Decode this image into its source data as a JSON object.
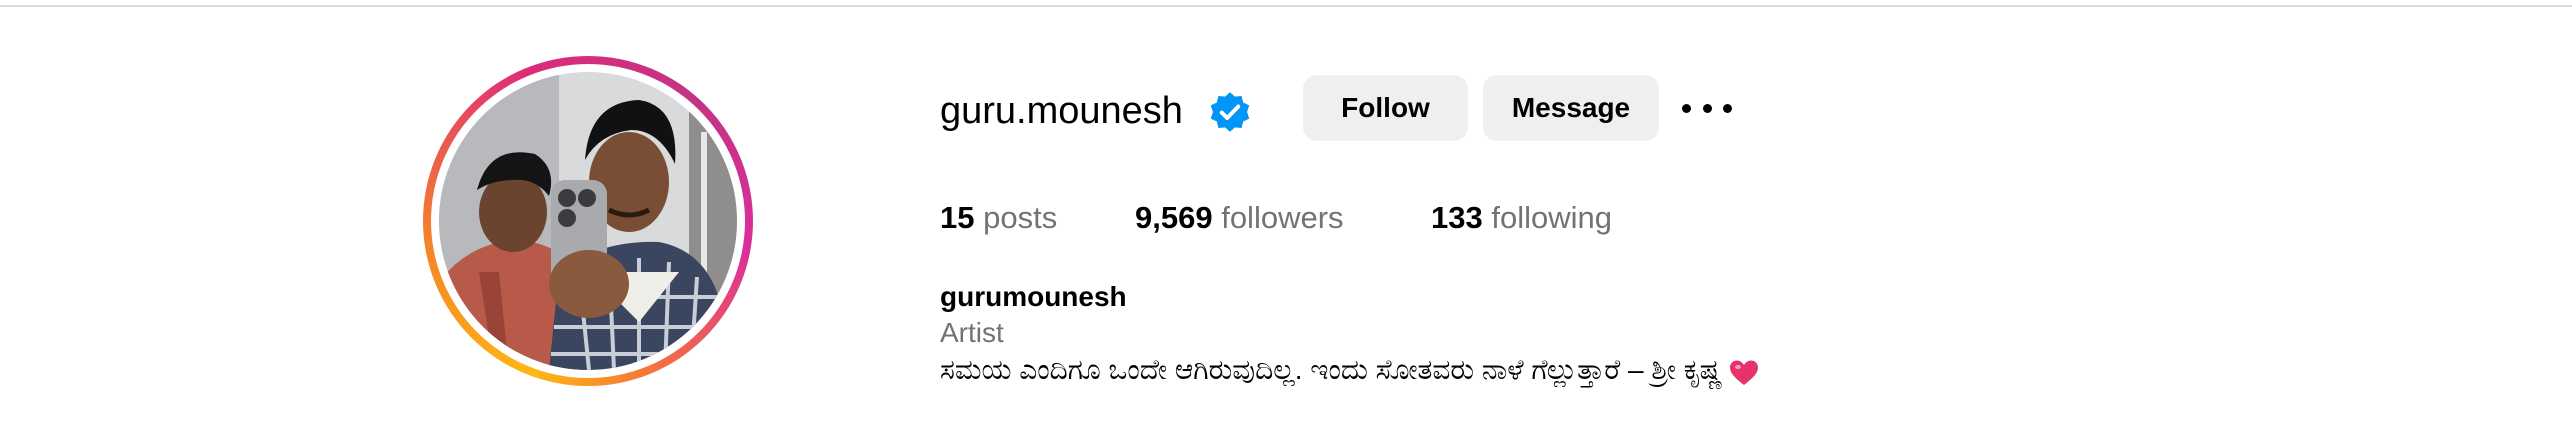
{
  "profile": {
    "username": "guru.mounesh",
    "verified": true,
    "full_name": "gurumounesh",
    "category": "Artist",
    "bio": "ಸಮಯ ಎಂದಿಗೂ ಒಂದೇ ಆಗಿರುವುದಿಲ್ಲ. ಇಂದು ಸೋತವರು ನಾಳೆ ಗೆಲ್ಲುತ್ತಾರೆ – ಶ್ರೀ ಕೃಷ್ಣ",
    "bio_emoji": "heart-emoji"
  },
  "actions": {
    "follow_label": "Follow",
    "message_label": "Message",
    "more_icon": "more-options-icon"
  },
  "stats": {
    "posts_count": "15",
    "posts_label": "posts",
    "followers_count": "9,569",
    "followers_label": "followers",
    "following_count": "133",
    "following_label": "following"
  },
  "colors": {
    "verified_blue": "#0095f6",
    "button_bg": "#efefef",
    "secondary_text": "#737373",
    "heart": "#e8336a"
  }
}
